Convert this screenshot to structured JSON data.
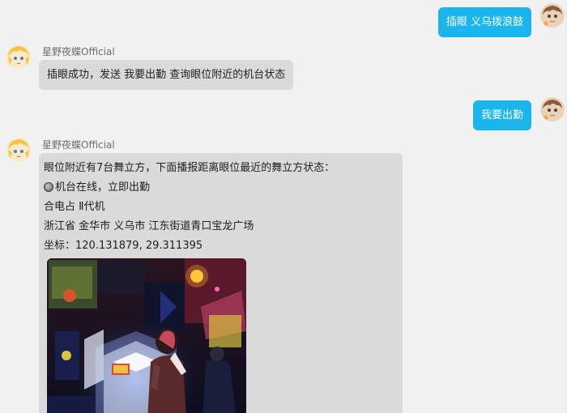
{
  "bot": {
    "name": "星野夜蝶Official"
  },
  "messages": {
    "user_msg_1": "插眼 义乌拨浪鼓",
    "bot_msg_1": "插眼成功，发送 我要出勤 查询眼位附近的机台状态",
    "user_msg_2": "我要出勤",
    "bot_msg_2": {
      "line1": "眼位附近有7台舞立方，下面播报距离眼位最近的舞立方状态：",
      "status": "机台在线，立即出勤",
      "machine": "合电占 Ⅱ代机",
      "address": "浙江省 金华市 义乌市 江东街道青口宝龙广场",
      "coordinates": "坐标：120.131879, 29.311395"
    }
  },
  "colors": {
    "user_bubble": "#1bb5ee",
    "bot_bubble": "#dadada",
    "background": "#f1f1f1"
  },
  "icons": {
    "status": "gray-circle-icon"
  }
}
